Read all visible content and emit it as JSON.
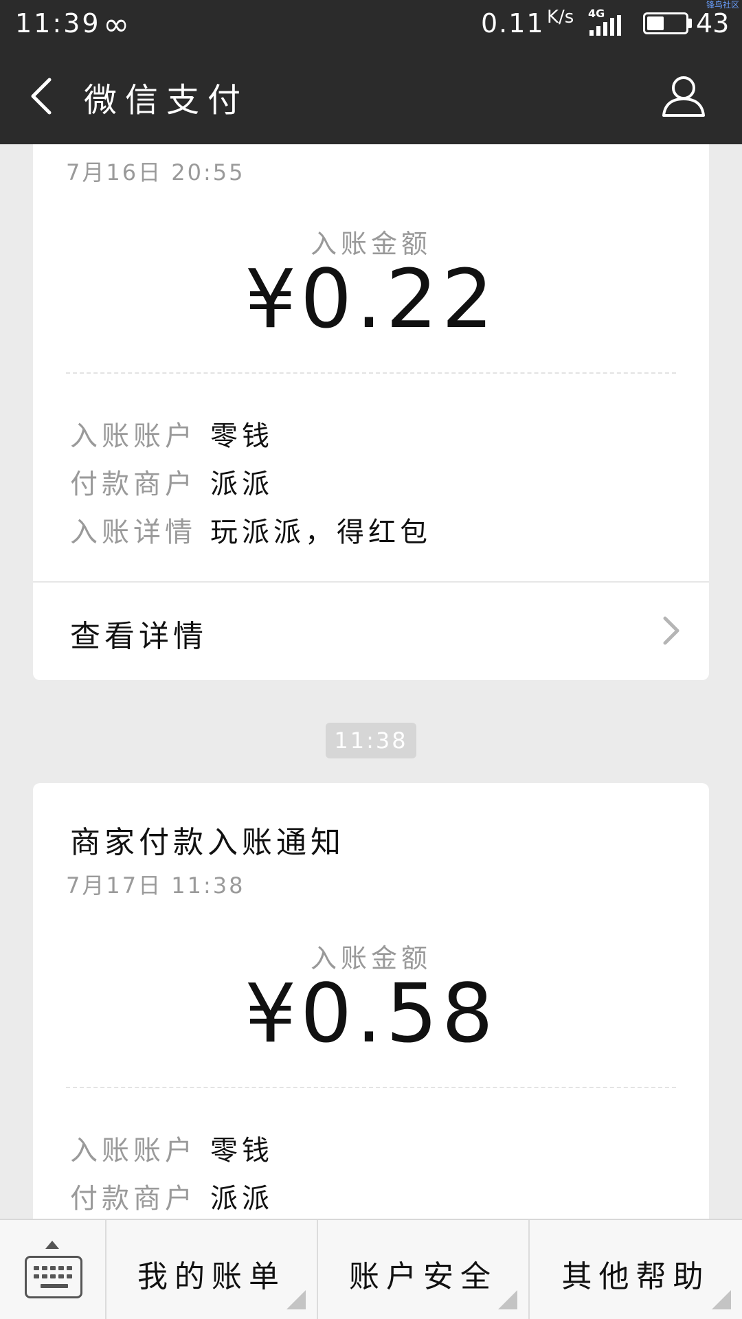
{
  "status_bar": {
    "time": "11:39",
    "infinity_symbol": "∞",
    "net_speed": "0.11",
    "net_speed_unit": "K/s",
    "network_type": "4G",
    "battery_level": "43",
    "watermark": "锋鸟社区"
  },
  "nav": {
    "title": "微信支付",
    "back_icon": "back-arrow-icon",
    "profile_icon": "user-icon"
  },
  "cards": [
    {
      "date": "7月16日 20:55",
      "amount_label": "入账金额",
      "amount": "¥0.22",
      "rows": [
        {
          "label": "入账账户",
          "value": "零钱"
        },
        {
          "label": "付款商户",
          "value": "派派"
        },
        {
          "label": "入账详情",
          "value": "玩派派，得红包"
        }
      ],
      "detail_link": "查看详情"
    },
    {
      "title": "商家付款入账通知",
      "date": "7月17日 11:38",
      "amount_label": "入账金额",
      "amount": "¥0.58",
      "rows": [
        {
          "label": "入账账户",
          "value": "零钱"
        },
        {
          "label": "付款商户",
          "value": "派派"
        }
      ]
    }
  ],
  "timestamp_badge": "11:38",
  "bottom_menu": {
    "keyboard_icon": "keyboard-icon",
    "items": [
      "我的账单",
      "账户安全",
      "其他帮助"
    ]
  },
  "colors": {
    "header_bg": "#2b2b2b",
    "page_bg": "#ebebeb",
    "card_bg": "#ffffff",
    "secondary_text": "#9a9a9a"
  }
}
